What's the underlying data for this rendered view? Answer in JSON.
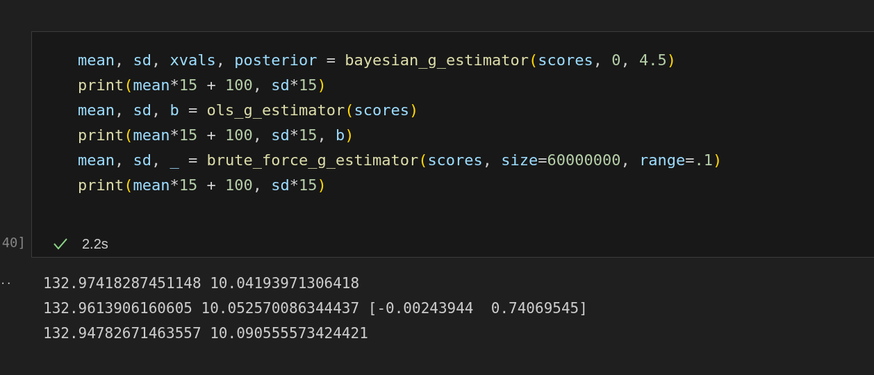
{
  "cell": {
    "execution_count": "40]",
    "code_lines": [
      [
        {
          "kind": "var",
          "text": "mean"
        },
        {
          "kind": "punct",
          "text": ", "
        },
        {
          "kind": "var",
          "text": "sd"
        },
        {
          "kind": "punct",
          "text": ", "
        },
        {
          "kind": "var",
          "text": "xvals"
        },
        {
          "kind": "punct",
          "text": ", "
        },
        {
          "kind": "var",
          "text": "posterior"
        },
        {
          "kind": "op",
          "text": " = "
        },
        {
          "kind": "func",
          "text": "bayesian_g_estimator"
        },
        {
          "kind": "paren",
          "text": "("
        },
        {
          "kind": "var",
          "text": "scores"
        },
        {
          "kind": "punct",
          "text": ", "
        },
        {
          "kind": "num",
          "text": "0"
        },
        {
          "kind": "punct",
          "text": ", "
        },
        {
          "kind": "num",
          "text": "4.5"
        },
        {
          "kind": "paren",
          "text": ")"
        }
      ],
      [
        {
          "kind": "func",
          "text": "print"
        },
        {
          "kind": "paren",
          "text": "("
        },
        {
          "kind": "var",
          "text": "mean"
        },
        {
          "kind": "op",
          "text": "*"
        },
        {
          "kind": "num",
          "text": "15"
        },
        {
          "kind": "op",
          "text": " + "
        },
        {
          "kind": "num",
          "text": "100"
        },
        {
          "kind": "punct",
          "text": ", "
        },
        {
          "kind": "var",
          "text": "sd"
        },
        {
          "kind": "op",
          "text": "*"
        },
        {
          "kind": "num",
          "text": "15"
        },
        {
          "kind": "paren",
          "text": ")"
        }
      ],
      [
        {
          "kind": "var",
          "text": "mean"
        },
        {
          "kind": "punct",
          "text": ", "
        },
        {
          "kind": "var",
          "text": "sd"
        },
        {
          "kind": "punct",
          "text": ", "
        },
        {
          "kind": "var",
          "text": "b"
        },
        {
          "kind": "op",
          "text": " = "
        },
        {
          "kind": "func",
          "text": "ols_g_estimator"
        },
        {
          "kind": "paren",
          "text": "("
        },
        {
          "kind": "var",
          "text": "scores"
        },
        {
          "kind": "paren",
          "text": ")"
        }
      ],
      [
        {
          "kind": "func",
          "text": "print"
        },
        {
          "kind": "paren",
          "text": "("
        },
        {
          "kind": "var",
          "text": "mean"
        },
        {
          "kind": "op",
          "text": "*"
        },
        {
          "kind": "num",
          "text": "15"
        },
        {
          "kind": "op",
          "text": " + "
        },
        {
          "kind": "num",
          "text": "100"
        },
        {
          "kind": "punct",
          "text": ", "
        },
        {
          "kind": "var",
          "text": "sd"
        },
        {
          "kind": "op",
          "text": "*"
        },
        {
          "kind": "num",
          "text": "15"
        },
        {
          "kind": "punct",
          "text": ", "
        },
        {
          "kind": "var",
          "text": "b"
        },
        {
          "kind": "paren",
          "text": ")"
        }
      ],
      [
        {
          "kind": "var",
          "text": "mean"
        },
        {
          "kind": "punct",
          "text": ", "
        },
        {
          "kind": "var",
          "text": "sd"
        },
        {
          "kind": "punct",
          "text": ", "
        },
        {
          "kind": "var",
          "text": "_"
        },
        {
          "kind": "op",
          "text": " = "
        },
        {
          "kind": "func",
          "text": "brute_force_g_estimator"
        },
        {
          "kind": "paren",
          "text": "("
        },
        {
          "kind": "var",
          "text": "scores"
        },
        {
          "kind": "punct",
          "text": ", "
        },
        {
          "kind": "var",
          "text": "size"
        },
        {
          "kind": "op",
          "text": "="
        },
        {
          "kind": "num",
          "text": "60000000"
        },
        {
          "kind": "punct",
          "text": ", "
        },
        {
          "kind": "var",
          "text": "range"
        },
        {
          "kind": "op",
          "text": "="
        },
        {
          "kind": "num",
          "text": ".1"
        },
        {
          "kind": "paren",
          "text": ")"
        }
      ],
      [
        {
          "kind": "func",
          "text": "print"
        },
        {
          "kind": "paren",
          "text": "("
        },
        {
          "kind": "var",
          "text": "mean"
        },
        {
          "kind": "op",
          "text": "*"
        },
        {
          "kind": "num",
          "text": "15"
        },
        {
          "kind": "op",
          "text": " + "
        },
        {
          "kind": "num",
          "text": "100"
        },
        {
          "kind": "punct",
          "text": ", "
        },
        {
          "kind": "var",
          "text": "sd"
        },
        {
          "kind": "op",
          "text": "*"
        },
        {
          "kind": "num",
          "text": "15"
        },
        {
          "kind": "paren",
          "text": ")"
        }
      ]
    ],
    "status": {
      "succeeded": true,
      "duration": "2.2s"
    }
  },
  "output": {
    "marker": "··",
    "lines": [
      "132.97418287451148 10.04193971306418",
      "132.9613906160605 10.052570086344437 [-0.00243944  0.74069545]",
      "132.94782671463557 10.090555573424421"
    ]
  }
}
